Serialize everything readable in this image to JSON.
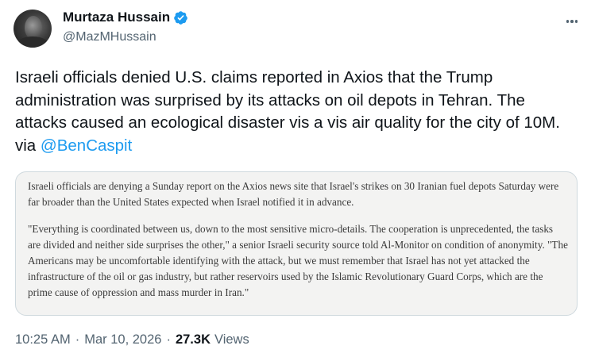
{
  "author": {
    "name": "Murtaza Hussain",
    "handle": "@MazMHussain",
    "verified_color": "#1d9bf0"
  },
  "tweet": {
    "text": "Israeli officials denied U.S. claims reported in Axios that the Trump administration was surprised by its attacks on oil depots in Tehran. The attacks caused an ecological disaster vis a vis air quality for the city of 10M. via ",
    "mention": "@BenCaspit"
  },
  "quote": {
    "paragraph1": "Israeli officials are denying a Sunday report on the Axios news site that Israel's strikes on 30 Iranian fuel depots Saturday were far broader than the United States expected when Israel notified it in advance.",
    "paragraph2": "\"Everything is coordinated between us, down to the most sensitive micro-details. The cooperation is unprecedented, the tasks are divided and neither side surprises the other,\" a senior Israeli security source told Al-Monitor on condition of anonymity. \"The Americans may be uncomfortable identifying with the attack, but we must remember that Israel has not yet attacked the infrastructure of the oil or gas industry, but rather reservoirs used by the Islamic Revolutionary Guard Corps, which are the prime cause of oppression and mass murder in Iran.\""
  },
  "meta": {
    "time": "10:25 AM",
    "separator": "·",
    "date": "Mar 10, 2026",
    "views_count": "27.3K",
    "views_label": "Views"
  },
  "icons": {
    "verified": "verified-badge-icon",
    "more": "more-options-icon"
  }
}
